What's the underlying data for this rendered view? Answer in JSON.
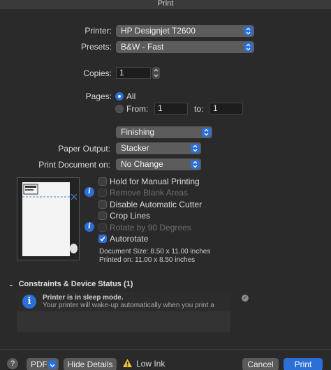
{
  "window": {
    "title": "Print"
  },
  "printer": {
    "label": "Printer:",
    "value": "HP Designjet T2600"
  },
  "presets": {
    "label": "Presets:",
    "value": "B&W - Fast"
  },
  "copies": {
    "label": "Copies:",
    "value": "1"
  },
  "pages": {
    "label": "Pages:",
    "all_label": "All",
    "from_label": "From:",
    "from_value": "1",
    "to_label": "to:",
    "to_value": "1",
    "selected": "All"
  },
  "section_popup": {
    "value": "Finishing"
  },
  "paper_output": {
    "label": "Paper Output:",
    "value": "Stacker"
  },
  "print_document_on": {
    "label": "Print Document on:",
    "value": "No Change"
  },
  "options": [
    {
      "label": "Hold for Manual Printing",
      "checked": false,
      "enabled": true
    },
    {
      "label": "Remove Blank Areas",
      "checked": false,
      "enabled": false
    },
    {
      "label": "Disable Automatic Cutter",
      "checked": false,
      "enabled": true
    },
    {
      "label": "Crop Lines",
      "checked": false,
      "enabled": true
    },
    {
      "label": "Rotate by 90 Degrees",
      "checked": false,
      "enabled": false
    },
    {
      "label": "Autorotate",
      "checked": true,
      "enabled": true
    }
  ],
  "document_size": "Document Size: 8.50 x 11.00 inches",
  "printed_on": "Printed on: 11.00 x 8.50 inches",
  "constraints": {
    "title": "Constraints & Device Status (1)",
    "status_title": "Printer is in sleep mode.",
    "status_detail": "Your printer will wake-up automatically when you print a"
  },
  "footer": {
    "help": "?",
    "pdf_label": "PDF",
    "hide_details_label": "Hide Details",
    "warning_text": "Low Ink",
    "cancel_label": "Cancel",
    "print_label": "Print"
  },
  "colors": {
    "accent": "#2c6fd6",
    "background": "#2a2a2a",
    "warning": "#f2c230"
  }
}
